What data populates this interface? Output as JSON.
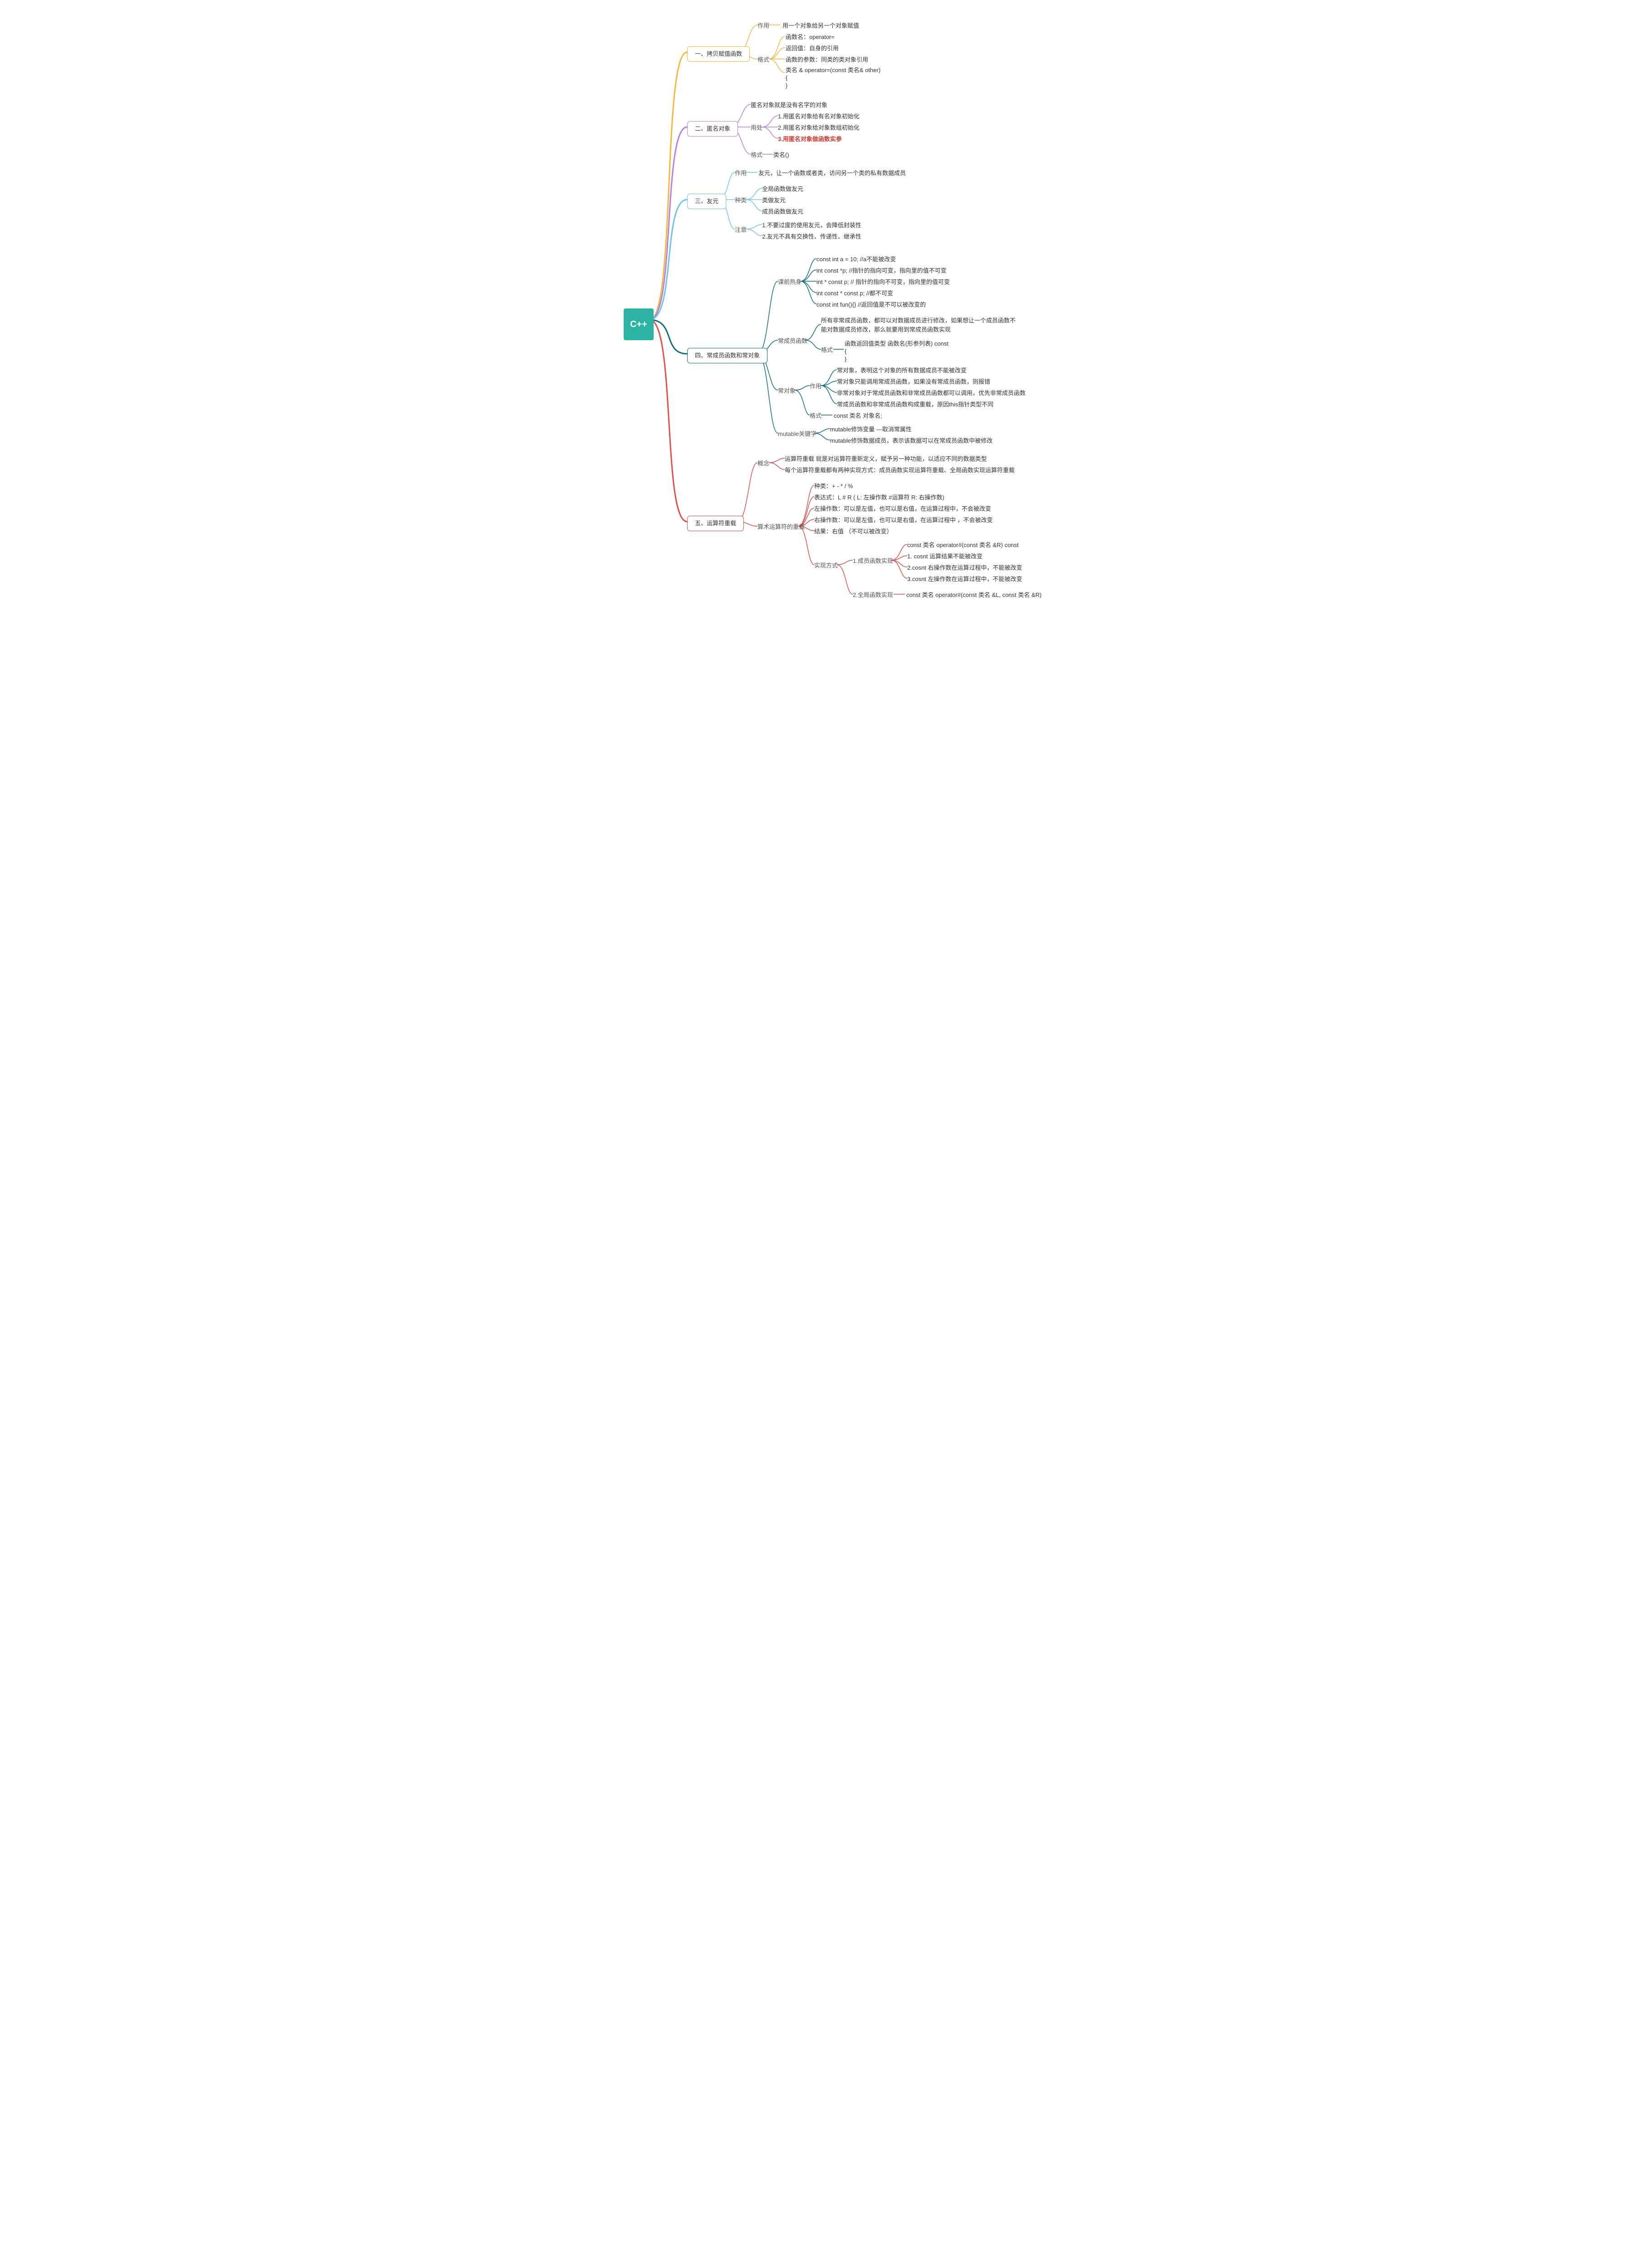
{
  "root": "C++",
  "b1": {
    "title": "一、拷贝赋值函数",
    "s1": {
      "label": "作用",
      "leaf": "用一个对象给另一个对象赋值"
    },
    "s2": {
      "label": "格式",
      "l1": "函数名：operator=",
      "l2": "返回值：自身的引用",
      "l3": "函数的参数：同类的类对象引用",
      "l4": "类名 & operator=(const 类名& other)\n{\n}"
    }
  },
  "b2": {
    "title": "二、匿名对象",
    "s1": "匿名对象就是没有名字的对象",
    "s2": {
      "label": "用处",
      "l1": "1.用匿名对象给有名对象初始化",
      "l2": "2.用匿名对象给对象数组初始化",
      "l3": "3.用匿名对象做函数实参"
    },
    "s3": {
      "label": "格式",
      "leaf": "类名()"
    }
  },
  "b3": {
    "title": "三、友元",
    "s1": {
      "label": "作用",
      "leaf": "友元，让一个函数或者类，访问另一个类的私有数据成员"
    },
    "s2": {
      "label": "种类",
      "l1": "全局函数做友元",
      "l2": "类做友元",
      "l3": "成员函数做友元"
    },
    "s3": {
      "label": "注意",
      "l1": "1.不要过度的使用友元，会降低封装性",
      "l2": "2.友元不具有交换性、传递性、继承性"
    }
  },
  "b4": {
    "title": "四、常成员函数和常对象",
    "s1": {
      "label": "课前热身",
      "l1": "const int a = 10;   //a不能被改变",
      "l2": "int const *p; //指针的指向可变，指向里的值不可变",
      "l3": "int * const p; // 指针的指向不可变，指向里的值可变",
      "l4": "int const * const p; //都不可变",
      "l5": "const int fun(){} //返回值是不可以被改变的"
    },
    "s2": {
      "label": "常成员函数",
      "l1": "所有非常成员函数，都可以对数据成员进行修改，如果想让一个成员函数不能对数据成员修改，那么就要用到常成员函数实现",
      "l2": {
        "label": "格式",
        "leaf": "函数返回值类型 函数名(形参列表) const\n{\n}"
      }
    },
    "s3": {
      "label": "常对象",
      "a": {
        "label": "作用",
        "l1": "常对象，表明这个对象的所有数据成员不能被改变",
        "l2": "常对象只能调用常成员函数，如果没有常成员函数，则报错",
        "l3": "非常对象对于常成员函数和非常成员函数都可以调用，优先非常成员函数",
        "l4": "常成员函数和非常成员函数构成重载，原因this指针类型不同"
      },
      "b": {
        "label": "格式",
        "leaf": "const 类名 对象名;"
      }
    },
    "s4": {
      "label": "mutable关键字",
      "l1": "mutable修饰变量 ---取消常属性",
      "l2": "mutable修饰数据成员，表示该数据可以在常成员函数中被修改"
    }
  },
  "b5": {
    "title": "五、运算符重载",
    "s1": {
      "label": "概念",
      "l1": "运算符重载 就是对运算符重新定义，赋予另一种功能，以适应不同的数据类型",
      "l2": "每个运算符重载都有两种实现方式：成员函数实现运算符重载、全局函数实现运算符重载"
    },
    "s2": {
      "label": "算术运算符的重载",
      "l1": "种类：+   -   *   /    %",
      "l2": "表达式：L  #  R  ( L: 左操作数  #运算符  R: 右操作数)",
      "l3": "左操作数：可以是左值，也可以是右值，在运算过程中，不会被改变",
      "l4": "右操作数：可以是左值，也可以是右值，在运算过程中 ，不会被改变",
      "l5": "结果：右值 （不可以被改变）",
      "l6": {
        "label": "实现方式",
        "a": {
          "label": "1.成员函数实现",
          "l1": "const 类名 operator#(const 类名 &R) const",
          "l2": "1. cosnt 运算结果不能被改变",
          "l3": "2.cosnt 右操作数在运算过程中，不能被改变",
          "l4": "3.cosnt 左操作数在运算过程中，不能被改变"
        },
        "b": {
          "label": "2.全局函数实现",
          "leaf": "const 类名 operator#(const 类名 &L, const 类名 &R)"
        }
      }
    }
  }
}
